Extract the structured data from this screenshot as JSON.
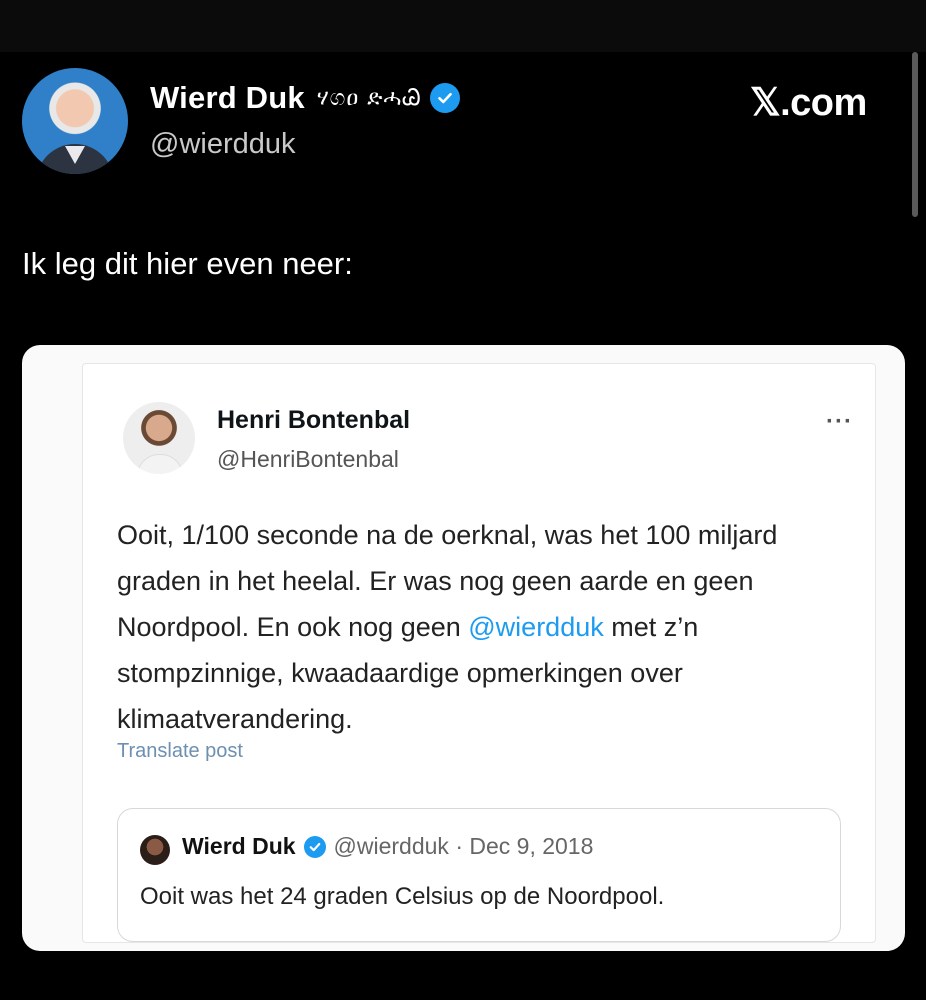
{
  "brand": {
    "label": "𝕏.com",
    "accent": "#1d9bf0"
  },
  "author": {
    "name": "Wierd Duk",
    "script_name": "ሃගዐ ድሓᏊ",
    "handle": "@wierdduk",
    "verified_icon": "verified-badge-icon"
  },
  "tweet": {
    "text": "Ik leg dit hier even neer:"
  },
  "embedded": {
    "name": "Henri Bontenbal",
    "handle": "@HenriBontenbal",
    "more_label": "···",
    "text_before": "Ooit, 1/100 seconde na de oerknal, was het 100 miljard graden in het heelal. Er was nog geen aarde en geen Noordpool. En ook nog geen ",
    "mention": "@wierdduk",
    "text_after": " met z’n stompzinnige, kwaadaardige opmerkingen over klimaatverandering.",
    "translate_label": "Translate post",
    "quoted": {
      "name": "Wierd Duk",
      "meta": "@wierdduk · Dec 9, 2018",
      "text": "Ooit was het 24 graden Celsius op de Noordpool."
    }
  }
}
